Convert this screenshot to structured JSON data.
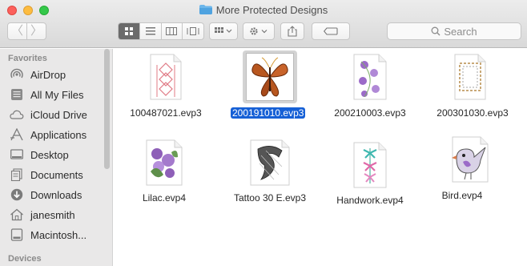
{
  "window": {
    "title": "More Protected Designs",
    "accent": "#1660d6"
  },
  "toolbar": {
    "back_glyph": "〈",
    "forward_glyph": "〉",
    "search_placeholder": "Search",
    "views": [
      "icon-view-icon",
      "list-view-icon",
      "column-view-icon",
      "gallery-view-icon"
    ],
    "active_view": "icon-view-icon"
  },
  "sidebar": {
    "favorites_label": "Favorites",
    "devices_label": "Devices",
    "items": [
      {
        "label": "AirDrop",
        "icon": "airdrop-icon"
      },
      {
        "label": "All My Files",
        "icon": "all-files-icon"
      },
      {
        "label": "iCloud Drive",
        "icon": "cloud-icon"
      },
      {
        "label": "Applications",
        "icon": "applications-icon"
      },
      {
        "label": "Desktop",
        "icon": "desktop-icon"
      },
      {
        "label": "Documents",
        "icon": "documents-icon"
      },
      {
        "label": "Downloads",
        "icon": "downloads-icon"
      },
      {
        "label": "janesmith",
        "icon": "home-icon"
      },
      {
        "label": "Macintosh...",
        "icon": "disk-icon"
      }
    ]
  },
  "files": [
    {
      "name": "100487021.evp3",
      "selected": false
    },
    {
      "name": "200191010.evp3",
      "selected": true
    },
    {
      "name": "200210003.evp3",
      "selected": false
    },
    {
      "name": "200301030.evp3",
      "selected": false
    },
    {
      "name": "Lilac.evp4",
      "selected": false
    },
    {
      "name": "Tattoo 30 E.evp3",
      "selected": false
    },
    {
      "name": "Handwork.evp4",
      "selected": false
    },
    {
      "name": "Bird.evp4",
      "selected": false
    }
  ]
}
